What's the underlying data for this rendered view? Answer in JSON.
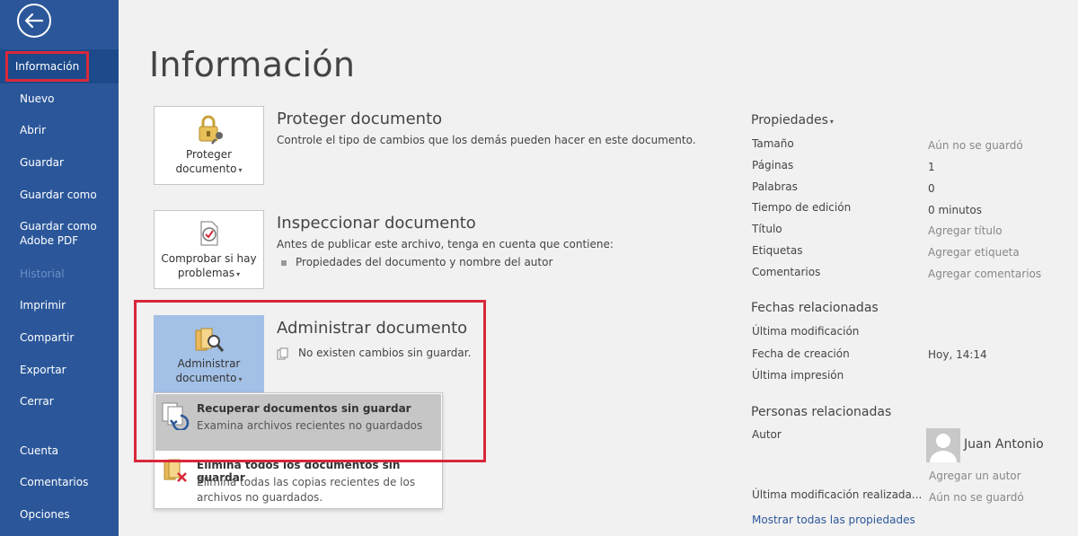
{
  "sidebar": {
    "items": [
      {
        "label": "Información"
      },
      {
        "label": "Nuevo"
      },
      {
        "label": "Abrir"
      },
      {
        "label": "Guardar"
      },
      {
        "label": "Guardar como"
      },
      {
        "label": "Guardar como Adobe PDF"
      },
      {
        "label": "Historial"
      },
      {
        "label": "Imprimir"
      },
      {
        "label": "Compartir"
      },
      {
        "label": "Exportar"
      },
      {
        "label": "Cerrar"
      },
      {
        "label": "Cuenta"
      },
      {
        "label": "Comentarios"
      },
      {
        "label": "Opciones"
      }
    ]
  },
  "page_title": "Información",
  "sections": {
    "protect": {
      "tile_line1": "Proteger",
      "tile_line2": "documento",
      "title": "Proteger documento",
      "desc": "Controle el tipo de cambios que los demás pueden hacer en este documento."
    },
    "inspect": {
      "tile_line1": "Comprobar si hay",
      "tile_line2": "problemas",
      "title": "Inspeccionar documento",
      "desc": "Antes de publicar este archivo, tenga en cuenta que contiene:",
      "bullet": "Propiedades del documento y nombre del autor"
    },
    "manage": {
      "tile_line1": "Administrar",
      "tile_line2": "documento",
      "title": "Administrar documento",
      "desc": "No existen cambios sin guardar."
    }
  },
  "dropdown": {
    "recover_title": "Recuperar documentos sin guardar",
    "recover_desc": "Examina archivos recientes no guardados",
    "delete_title": "Elimina todos los documentos sin guardar",
    "delete_desc_1": "Elimina todas las copias recientes de los",
    "delete_desc_2": "archivos no guardados."
  },
  "properties": {
    "heading": "Propiedades",
    "rows": [
      {
        "key": "Tamaño",
        "value": "Aún no se guardó"
      },
      {
        "key": "Páginas",
        "value": "1"
      },
      {
        "key": "Palabras",
        "value": "0"
      },
      {
        "key": "Tiempo de edición",
        "value": "0 minutos"
      },
      {
        "key": "Título",
        "value": "Agregar título"
      },
      {
        "key": "Etiquetas",
        "value": "Agregar etiqueta"
      },
      {
        "key": "Comentarios",
        "value": "Agregar comentarios"
      }
    ]
  },
  "dates": {
    "heading": "Fechas relacionadas",
    "rows": [
      {
        "key": "Última modificación",
        "value": ""
      },
      {
        "key": "Fecha de creación",
        "value": "Hoy, 14:14"
      },
      {
        "key": "Última impresión",
        "value": ""
      }
    ]
  },
  "people": {
    "heading": "Personas relacionadas",
    "author_label": "Autor",
    "author_name": "Juan Antonio",
    "add_author": "Agregar un autor",
    "last_modified_by_label": "Última modificación realizada...",
    "last_modified_by_value": "Aún no se guardó",
    "show_all": "Mostrar todas las propiedades"
  },
  "colors": {
    "sidebar": "#2b579a",
    "highlight": "#d8283a",
    "selected_tile": "#a3c0e6"
  }
}
